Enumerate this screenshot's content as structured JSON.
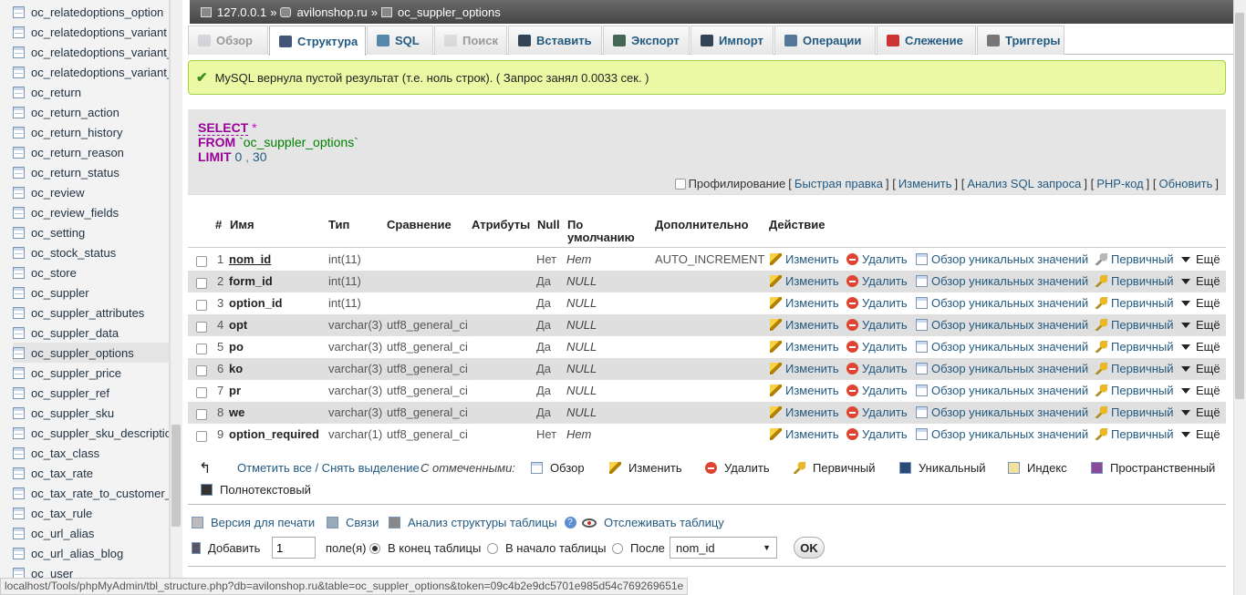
{
  "sidebar": {
    "items": [
      {
        "label": "oc_relatedoptions_option"
      },
      {
        "label": "oc_relatedoptions_variant"
      },
      {
        "label": "oc_relatedoptions_variant_"
      },
      {
        "label": "oc_relatedoptions_variant_"
      },
      {
        "label": "oc_return"
      },
      {
        "label": "oc_return_action"
      },
      {
        "label": "oc_return_history"
      },
      {
        "label": "oc_return_reason"
      },
      {
        "label": "oc_return_status"
      },
      {
        "label": "oc_review"
      },
      {
        "label": "oc_review_fields"
      },
      {
        "label": "oc_setting"
      },
      {
        "label": "oc_stock_status"
      },
      {
        "label": "oc_store"
      },
      {
        "label": "oc_suppler"
      },
      {
        "label": "oc_suppler_attributes"
      },
      {
        "label": "oc_suppler_data"
      },
      {
        "label": "oc_suppler_options"
      },
      {
        "label": "oc_suppler_price"
      },
      {
        "label": "oc_suppler_ref"
      },
      {
        "label": "oc_suppler_sku"
      },
      {
        "label": "oc_suppler_sku_descriptic"
      },
      {
        "label": "oc_tax_class"
      },
      {
        "label": "oc_tax_rate"
      },
      {
        "label": "oc_tax_rate_to_customer_"
      },
      {
        "label": "oc_tax_rule"
      },
      {
        "label": "oc_url_alias"
      },
      {
        "label": "oc_url_alias_blog"
      },
      {
        "label": "oc_user"
      }
    ],
    "active_index": 17
  },
  "breadcrumb": {
    "server": "127.0.0.1",
    "db": "avilonshop.ru",
    "table": "oc_suppler_options",
    "sep": "»"
  },
  "tabs": [
    {
      "label": "Обзор",
      "state": "disabled",
      "icon": "browse-icon"
    },
    {
      "label": "Структура",
      "state": "active",
      "icon": "structure-icon"
    },
    {
      "label": "SQL",
      "state": "normal",
      "icon": "sql-icon"
    },
    {
      "label": "Поиск",
      "state": "disabled",
      "icon": "search-icon"
    },
    {
      "label": "Вставить",
      "state": "normal",
      "icon": "insert-icon"
    },
    {
      "label": "Экспорт",
      "state": "normal",
      "icon": "export-icon"
    },
    {
      "label": "Импорт",
      "state": "normal",
      "icon": "import-icon"
    },
    {
      "label": "Операции",
      "state": "normal",
      "icon": "wrench-icon"
    },
    {
      "label": "Слежение",
      "state": "normal",
      "icon": "eye-icon"
    },
    {
      "label": "Триггеры",
      "state": "normal",
      "icon": "triggers-icon"
    }
  ],
  "message": "MySQL вернула пустой результат (т.е. ноль строк). ( Запрос занял 0.0033 сек. )",
  "sql": {
    "line1_kw": "SELECT",
    "line1_rest": "*",
    "line2_kw": "FROM",
    "line2_rest": "`oc_suppler_options`",
    "line3_kw": "LIMIT",
    "line3_a": "0",
    "line3_sep": ",",
    "line3_b": "30"
  },
  "sqlbar": {
    "profiling": "Профилирование",
    "quick_edit": "Быстрая правка",
    "edit": "Изменить",
    "analyze": "Анализ SQL запроса",
    "php": "PHP-код",
    "refresh": "Обновить"
  },
  "columns": {
    "num": "#",
    "name": "Имя",
    "type": "Тип",
    "collation": "Сравнение",
    "attributes": "Атрибуты",
    "null": "Null",
    "default_l1": "По",
    "default_l2": "умолчанию",
    "extra": "Дополнительно",
    "action": "Действие"
  },
  "rows": [
    {
      "n": "1",
      "name": "nom_id",
      "type": "int(11)",
      "coll": "",
      "nul": "Нет",
      "def": "Нет",
      "extra": "AUTO_INCREMENT",
      "primary": true
    },
    {
      "n": "2",
      "name": "form_id",
      "type": "int(11)",
      "coll": "",
      "nul": "Да",
      "def": "NULL",
      "extra": "",
      "primary": false
    },
    {
      "n": "3",
      "name": "option_id",
      "type": "int(11)",
      "coll": "",
      "nul": "Да",
      "def": "NULL",
      "extra": "",
      "primary": false
    },
    {
      "n": "4",
      "name": "opt",
      "type": "varchar(3)",
      "coll": "utf8_general_ci",
      "nul": "Да",
      "def": "NULL",
      "extra": "",
      "primary": false
    },
    {
      "n": "5",
      "name": "po",
      "type": "varchar(3)",
      "coll": "utf8_general_ci",
      "nul": "Да",
      "def": "NULL",
      "extra": "",
      "primary": false
    },
    {
      "n": "6",
      "name": "ko",
      "type": "varchar(3)",
      "coll": "utf8_general_ci",
      "nul": "Да",
      "def": "NULL",
      "extra": "",
      "primary": false
    },
    {
      "n": "7",
      "name": "pr",
      "type": "varchar(3)",
      "coll": "utf8_general_ci",
      "nul": "Да",
      "def": "NULL",
      "extra": "",
      "primary": false
    },
    {
      "n": "8",
      "name": "we",
      "type": "varchar(3)",
      "coll": "utf8_general_ci",
      "nul": "Да",
      "def": "NULL",
      "extra": "",
      "primary": false
    },
    {
      "n": "9",
      "name": "option_required",
      "type": "varchar(1)",
      "coll": "utf8_general_ci",
      "nul": "Нет",
      "def": "Нет",
      "extra": "",
      "primary": false
    }
  ],
  "row_actions": {
    "edit": "Изменить",
    "delete": "Удалить",
    "browse": "Обзор уникальных значений",
    "primary": "Первичный",
    "more": "Ещё"
  },
  "bulk": {
    "check_all": "Отметить все / Снять выделение",
    "with_selected": "С отмеченными:",
    "browse": "Обзор",
    "edit": "Изменить",
    "delete": "Удалить",
    "primary": "Первичный",
    "unique": "Уникальный",
    "index": "Индекс",
    "spatial": "Пространственный",
    "fulltext": "Полнотекстовый"
  },
  "links": {
    "print": "Версия для печати",
    "relations": "Связи",
    "propose": "Анализ структуры таблицы",
    "track": "Отслеживать таблицу"
  },
  "add": {
    "label": "Добавить",
    "count": "1",
    "fields": "поле(я)",
    "at_end": "В конец таблицы",
    "at_begin": "В начало таблицы",
    "after": "После",
    "after_field": "nom_id",
    "ok": "OK"
  },
  "status_url": "localhost/Tools/phpMyAdmin/tbl_structure.php?db=avilonshop.ru&table=oc_suppler_options&token=09c4b2e9dc5701e985d54c769269651e"
}
